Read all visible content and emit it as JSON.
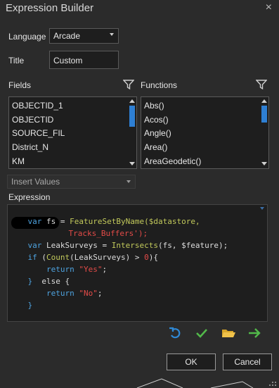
{
  "window": {
    "title": "Expression Builder",
    "close_symbol": "×"
  },
  "form": {
    "language_label": "Language",
    "language_value": "Arcade",
    "title_label": "Title",
    "title_value": "Custom"
  },
  "fields": {
    "label": "Fields",
    "items": [
      "OBJECTID_1",
      "OBJECTID",
      "SOURCE_FIL",
      "District_N",
      "KM"
    ]
  },
  "functions": {
    "label": "Functions",
    "items": [
      "Abs()",
      "Acos()",
      "Angle()",
      "Area()",
      "AreaGeodetic()"
    ]
  },
  "insert_values": {
    "label": "Insert Values"
  },
  "expression": {
    "label": "Expression",
    "lines": [
      [
        "var",
        " fs = ",
        "FeatureSetByName",
        "($datastore,"
      ],
      [
        "",
        "",
        "",
        "Tracks_Buffers');"
      ],
      [
        "var",
        " LeakSurveys = ",
        "Intersects",
        "(fs, $feature);"
      ],
      [
        "if",
        " (",
        "Count",
        "(LeakSurveys) > ",
        "0",
        "){"
      ],
      [
        "",
        "    ",
        "return",
        " ",
        "\"Yes\"",
        ";"
      ],
      [
        "}",
        "  else {",
        "",
        "",
        "",
        ""
      ],
      [
        "",
        "    ",
        "return",
        " ",
        "\"No\"",
        ";"
      ],
      [
        "}",
        "",
        "",
        "",
        "",
        ""
      ]
    ]
  },
  "toolbar": {
    "icons": [
      "undo-icon",
      "verify-check-icon",
      "open-folder-icon",
      "next-arrow-icon"
    ]
  },
  "buttons": {
    "ok": "OK",
    "cancel": "Cancel"
  },
  "colors": {
    "keyword": "#4ea3e0",
    "function": "#c2c95b",
    "string": "#e34b48",
    "accent": "#2e7fd3"
  }
}
